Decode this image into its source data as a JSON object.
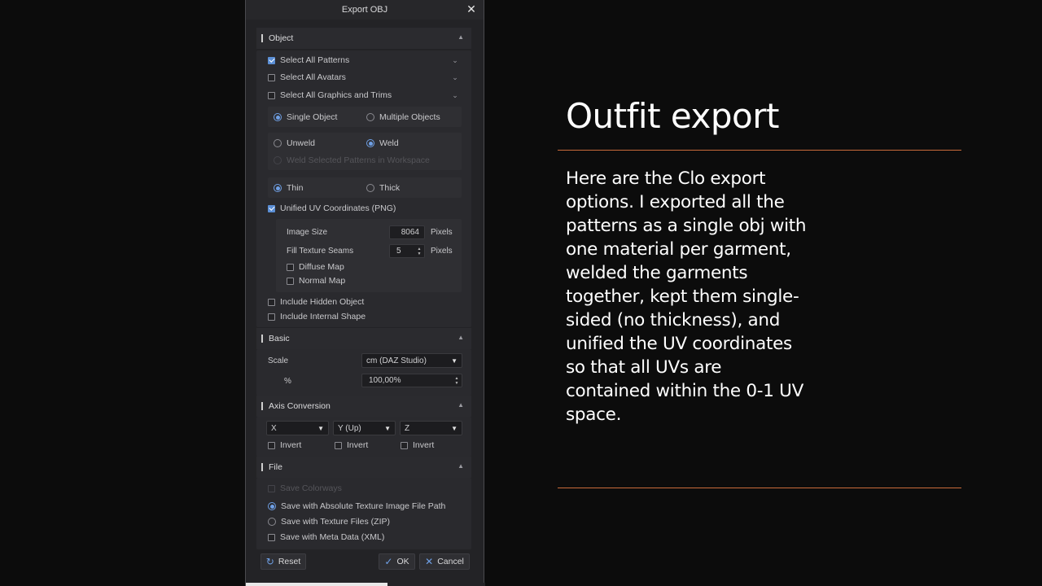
{
  "dialog": {
    "title": "Export OBJ",
    "close_glyph": "✕",
    "sections": {
      "object": {
        "title": "Object",
        "select_all_patterns": "Select All Patterns",
        "select_all_avatars": "Select All Avatars",
        "select_all_graphics": "Select All Graphics and Trims",
        "single_object": "Single Object",
        "multiple_objects": "Multiple Objects",
        "unweld": "Unweld",
        "weld": "Weld",
        "weld_selected": "Weld Selected Patterns in Workspace",
        "thin": "Thin",
        "thick": "Thick",
        "unified_uv": "Unified UV Coordinates (PNG)",
        "image_size_label": "Image Size",
        "image_size_value": "8064",
        "image_size_unit": "Pixels",
        "fill_seams_label": "Fill Texture Seams",
        "fill_seams_value": "5",
        "fill_seams_unit": "Pixels",
        "diffuse_map": "Diffuse Map",
        "normal_map": "Normal Map",
        "include_hidden": "Include Hidden Object",
        "include_internal": "Include Internal Shape"
      },
      "basic": {
        "title": "Basic",
        "scale_label": "Scale",
        "scale_value": "cm (DAZ Studio)",
        "percent_label": "%",
        "percent_value": "100,00%"
      },
      "axis": {
        "title": "Axis Conversion",
        "x_value": "X",
        "y_value": "Y (Up)",
        "z_value": "Z",
        "invert": "Invert"
      },
      "file": {
        "title": "File",
        "save_colorways": "Save Colorways",
        "save_absolute": "Save with Absolute Texture Image File Path",
        "save_texture_zip": "Save with Texture Files (ZIP)",
        "save_meta": "Save with Meta Data (XML)"
      }
    },
    "buttons": {
      "reset": "Reset",
      "ok": "OK",
      "cancel": "Cancel"
    }
  },
  "slide": {
    "title": "Outfit export",
    "body": "Here are the Clo export options. I exported all the patterns as a single obj with one material per garment, welded the garments together, kept them single-sided (no thickness), and unified the UV coordinates so that all UVs are contained within the 0-1 UV space."
  },
  "colors": {
    "accent": "#5b8fd6",
    "rule": "#c96b3a",
    "dialog_bg": "#232326"
  }
}
